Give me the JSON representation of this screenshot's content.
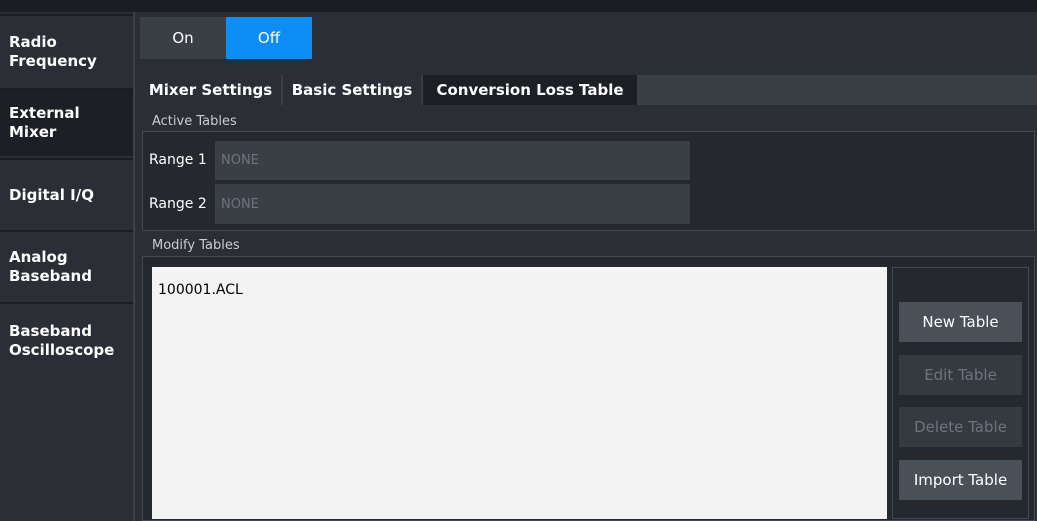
{
  "sidebar": {
    "items": [
      {
        "label": "Radio\nFrequency"
      },
      {
        "label": "External\nMixer"
      },
      {
        "label": "Digital I/Q"
      },
      {
        "label": "Analog\nBaseband"
      },
      {
        "label": "Baseband\nOscilloscope"
      }
    ],
    "active_index": 1
  },
  "toggle": {
    "on_label": "On",
    "off_label": "Off",
    "selected": "Off"
  },
  "tabs": [
    {
      "label": "Mixer Settings"
    },
    {
      "label": "Basic Settings"
    },
    {
      "label": "Conversion Loss Table"
    }
  ],
  "active_tables": {
    "title": "Active Tables",
    "rows": [
      {
        "label": "Range 1",
        "value": "NONE"
      },
      {
        "label": "Range 2",
        "value": "NONE"
      }
    ]
  },
  "modify_tables": {
    "title": "Modify Tables",
    "files": [
      "100001.ACL"
    ],
    "buttons": {
      "new": "New Table",
      "edit": "Edit Table",
      "delete": "Delete Table",
      "import": "Import Table"
    }
  },
  "colors": {
    "accent": "#0d8ef7",
    "panel": "#2b2f35",
    "active_tab": "#1c1f23",
    "list_bg": "#f3f3f3"
  }
}
